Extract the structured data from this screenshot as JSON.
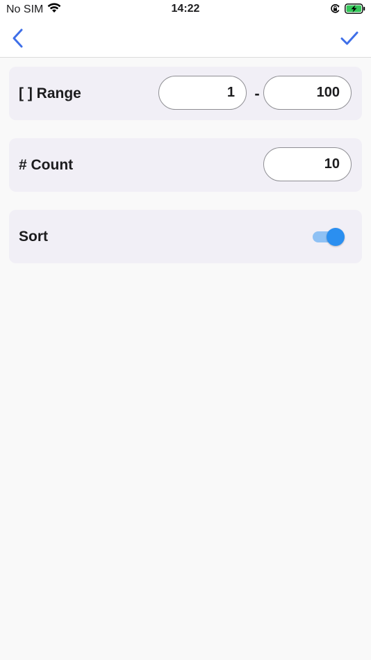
{
  "status_bar": {
    "carrier": "No SIM",
    "time": "14:22"
  },
  "colors": {
    "accent": "#3f6fe8",
    "toggle_on": "#2b8ff0",
    "battery_green": "#34c759",
    "card_background": "#f1eff6"
  },
  "nav": {
    "back_icon": "chevron-left-icon",
    "done_icon": "checkmark-icon"
  },
  "range": {
    "label": "[ ] Range",
    "from_value": "1",
    "separator": "-",
    "to_value": "100"
  },
  "count": {
    "label": "# Count",
    "value": "10"
  },
  "sort": {
    "label": "Sort",
    "enabled": true
  }
}
